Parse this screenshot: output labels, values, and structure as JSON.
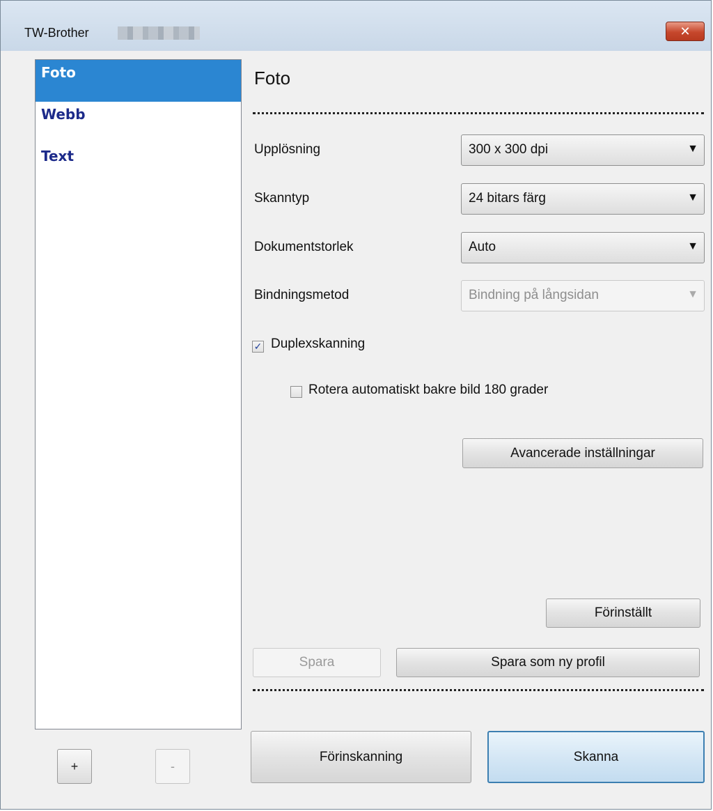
{
  "window": {
    "title": "TW-Brother",
    "close_label": "✕"
  },
  "profiles": [
    {
      "label": "Foto",
      "selected": true
    },
    {
      "label": "Webb",
      "selected": false
    },
    {
      "label": "Text",
      "selected": false
    }
  ],
  "list_buttons": {
    "add": "+",
    "remove": "-"
  },
  "panel": {
    "title": "Foto",
    "resolution": {
      "label": "Upplösning",
      "value": "300 x 300 dpi"
    },
    "scan_type": {
      "label": "Skanntyp",
      "value": "24 bitars färg"
    },
    "doc_size": {
      "label": "Dokumentstorlek",
      "value": "Auto"
    },
    "binding": {
      "label": "Bindningsmetod",
      "value": "Bindning på långsidan"
    },
    "duplex": {
      "label": "Duplexskanning",
      "checked": true
    },
    "rotate": {
      "label": "Rotera automatiskt bakre bild 180 grader",
      "checked": false
    },
    "advanced_button": "Avancerade inställningar",
    "default_button": "Förinställt",
    "save_button": "Spara",
    "save_new_button": "Spara som ny profil",
    "prescan_button": "Förinskanning",
    "scan_button": "Skanna"
  },
  "icons": {
    "dropdown": "chevron-down-icon",
    "check": "check-icon"
  }
}
